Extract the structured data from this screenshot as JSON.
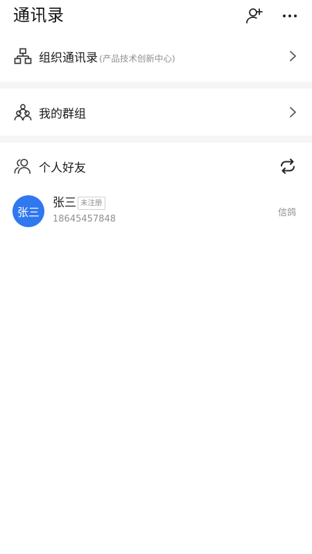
{
  "header": {
    "title": "通讯录",
    "add_icon": "add-user-icon",
    "more_icon": "more-icon"
  },
  "sections": {
    "org": {
      "label": "组织通讯录",
      "sublabel": "(产品技术创新中心)",
      "icon": "org-chart-icon"
    },
    "groups": {
      "label": "我的群组",
      "icon": "group-icon"
    },
    "friends": {
      "label": "个人好友",
      "icon": "friends-icon",
      "action_icon": "refresh-icon"
    }
  },
  "contacts": [
    {
      "avatar_text": "张三",
      "name": "张三",
      "badge": "未注册",
      "phone": "18645457848",
      "source": "信鸽"
    }
  ],
  "colors": {
    "accent": "#2f78f0",
    "divider": "#f5f5f5",
    "muted_text": "#8f8f8f"
  }
}
